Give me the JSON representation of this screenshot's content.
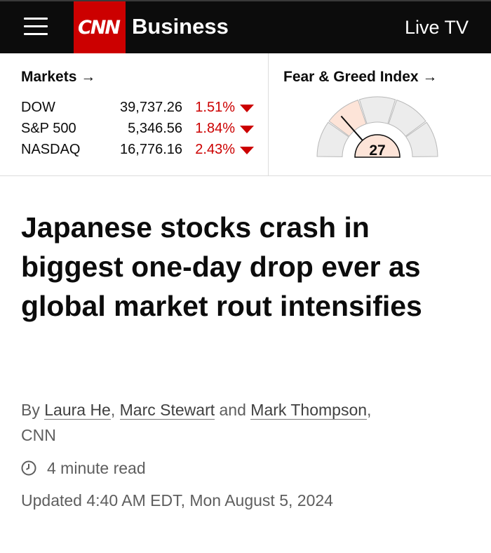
{
  "header": {
    "logo_text": "CNN",
    "section": "Business",
    "live_tv": "Live TV",
    "colors": {
      "background": "#0c0c0c",
      "brand_red": "#cc0000"
    },
    "menu_icon": "hamburger-menu-icon"
  },
  "markets": {
    "title": "Markets →",
    "indices": [
      {
        "name": "DOW",
        "value": "39,737.26",
        "change": "1.51%",
        "direction": "down"
      },
      {
        "name": "S&P 500",
        "value": "5,346.56",
        "change": "1.84%",
        "direction": "down"
      },
      {
        "name": "NASDAQ",
        "value": "16,776.16",
        "change": "2.43%",
        "direction": "down"
      }
    ],
    "down_color": "#cc0000"
  },
  "fear_greed": {
    "title": "Fear & Greed Index →",
    "value": "27",
    "level": 27,
    "highlight_color": "#fde4d8"
  },
  "article": {
    "headline": "Japanese stocks crash in biggest one-day drop ever as global market rout intensifies",
    "byline_prefix": "By ",
    "authors": [
      "Laura He",
      "Marc Stewart",
      "Mark Thompson"
    ],
    "byline_sep": ", ",
    "byline_and": " and ",
    "byline_suffix": ",",
    "byline_org": "CNN",
    "read_time": "4 minute read",
    "updated": "Updated 4:40 AM EDT, Mon August 5, 2024"
  }
}
